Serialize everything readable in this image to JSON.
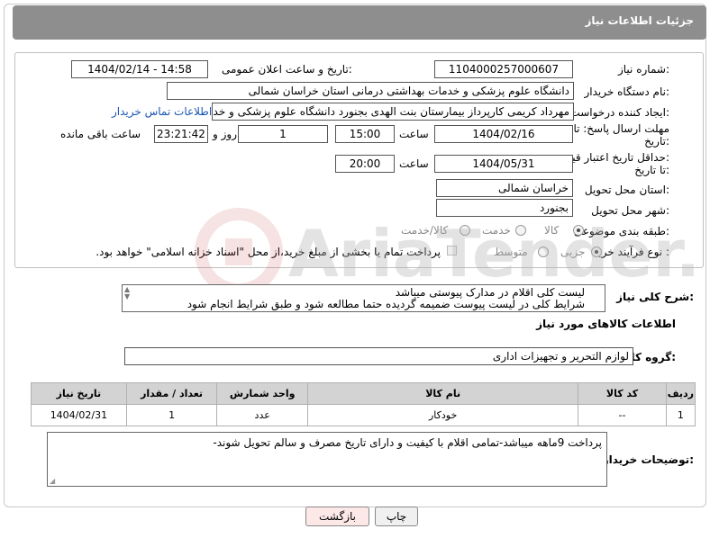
{
  "header": {
    "title": "جزئیات اطلاعات نیاز"
  },
  "form": {
    "need_number": {
      "label": "شماره نیاز:",
      "value": "1104000257000607"
    },
    "announce": {
      "label": "تاریخ و ساعت اعلان عمومی:",
      "value": "1404/02/14 - 14:58"
    },
    "buyer_org": {
      "label": "نام دستگاه خریدار:",
      "value": "دانشگاه علوم پزشکی و خدمات بهداشتی درمانی استان خراسان شمالی"
    },
    "requester": {
      "label": "ایجاد کننده درخواست:",
      "value": "مهرداد کریمی کارپرداز بیمارستان بنت الهدی بجنورد دانشگاه علوم پزشکی و خد",
      "contact_link": "اطلاعات تماس خریدار"
    },
    "response_deadline": {
      "label_line1": "مهلت ارسال پاسخ: تا",
      "label_line2": "تاریخ:",
      "date": "1404/02/16",
      "time_label": "ساعت",
      "time": "15:00",
      "days": "1",
      "days_label": "روز و",
      "remaining": "23:21:42",
      "remaining_label": "ساعت باقی مانده"
    },
    "price_validity": {
      "label_line1": "حداقل تاریخ اعتبار قیمت:",
      "label_line2": "تا تاریخ:",
      "date": "1404/05/31",
      "time_label": "ساعت",
      "time": "20:00"
    },
    "province": {
      "label": "استان محل تحویل:",
      "value": "خراسان شمالی"
    },
    "city": {
      "label": "شهر محل تحویل:",
      "value": "بجنورد"
    },
    "category": {
      "label": "طبقه بندی موضوعی:",
      "options": [
        "کالا",
        "خدمت",
        "کالا/خدمت"
      ],
      "selected": "کالا"
    },
    "purchase_type": {
      "label": "نوع فرآیند خرید :",
      "options": [
        "جزیی",
        "متوسط"
      ],
      "selected": "جزیی",
      "payment_note": "پرداخت تمام یا بخشی از مبلغ خرید،از محل \"اسناد خزانه اسلامی\" خواهد بود."
    }
  },
  "description": {
    "label": "شرح کلی نیاز:",
    "line1": "لیست کلی اقلام در  مدارک پیوستی میباشد",
    "line2": "شرایط کلی در لیست پیوست ضمیمه گردیده حتما مطالعه شود و طبق شرایط انجام شود"
  },
  "goods_section": {
    "title": "اطلاعات کالاهای مورد نیاز",
    "group_label": "گروه کالا:",
    "group_value": "لوازم التحریر و تجهیزات اداری"
  },
  "items_table": {
    "columns": [
      "ردیف",
      "کد کالا",
      "نام کالا",
      "واحد شمارش",
      "تعداد / مقدار",
      "تاریخ نیاز"
    ],
    "rows": [
      [
        "1",
        "--",
        "خودکار",
        "عدد",
        "1",
        "1404/02/31"
      ]
    ]
  },
  "buyer_notes": {
    "label": "توضیحات خریدار:",
    "text": "پرداخت 9ماهه میباشد-تمامی اقلام با کیفیت و دارای تاریخ مصرف و سالم تحویل شوند-"
  },
  "buttons": {
    "print": "چاپ",
    "back": "بازگشت"
  },
  "watermark": {
    "text": "AriaTender.neT"
  },
  "colors": {
    "header": "#8e8e8e",
    "link": "#1a55b5",
    "back_button": "#fde8e8"
  }
}
